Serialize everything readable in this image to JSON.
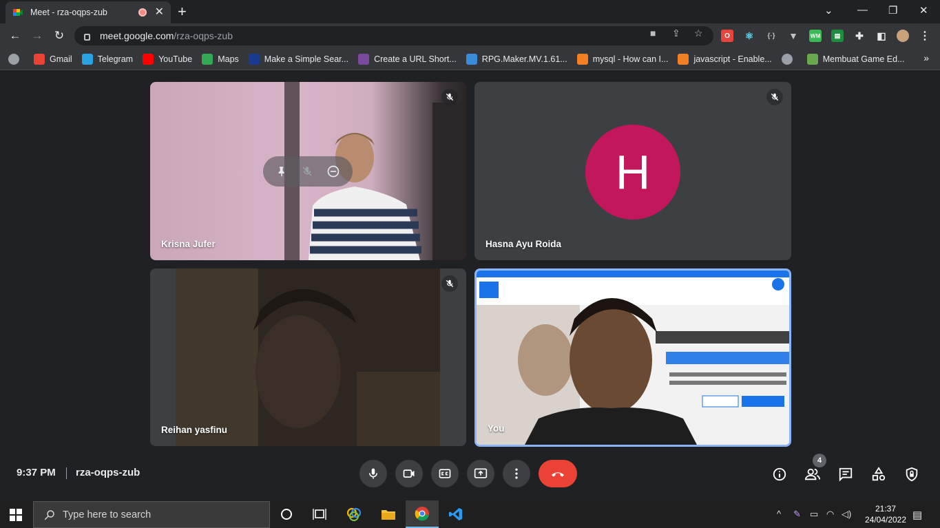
{
  "browser": {
    "tab_title": "Meet - rza-oqps-zub",
    "url_host": "meet.google.com",
    "url_path": "/rza-oqps-zub"
  },
  "bookmarks": [
    {
      "label": "",
      "icon": "globe-icon",
      "color": "#9aa0a6"
    },
    {
      "label": "Gmail",
      "icon": "gmail-icon",
      "color": "#ea4335"
    },
    {
      "label": "Telegram",
      "icon": "telegram-icon",
      "color": "#2aa3e0"
    },
    {
      "label": "YouTube",
      "icon": "youtube-icon",
      "color": "#ff0000"
    },
    {
      "label": "Maps",
      "icon": "maps-icon",
      "color": "#34a853"
    },
    {
      "label": "Make a Simple Sear...",
      "icon": "bookmark-icon",
      "color": "#1a3a8f"
    },
    {
      "label": "Create a URL Short...",
      "icon": "bookmark-icon",
      "color": "#7b4aa0"
    },
    {
      "label": "RPG.Maker.MV.1.61...",
      "icon": "bookmark-icon",
      "color": "#3a8bd8"
    },
    {
      "label": "mysql - How can I...",
      "icon": "stackoverflow-icon",
      "color": "#f48024"
    },
    {
      "label": "javascript - Enable...",
      "icon": "stackoverflow-icon",
      "color": "#f48024"
    },
    {
      "label": "",
      "icon": "globe-icon",
      "color": "#9aa0a6"
    },
    {
      "label": "Membuat Game Ed...",
      "icon": "bookmark-icon",
      "color": "#6aa84f"
    }
  ],
  "participants": [
    {
      "name": "Krisna Jufer",
      "muted": true
    },
    {
      "name": "Hasna Ayu Roida",
      "muted": true,
      "avatar_letter": "H",
      "avatar_color": "#c2185b"
    },
    {
      "name": "Reihan yasfinu",
      "muted": true
    },
    {
      "name": "You",
      "muted": false
    }
  ],
  "meeting": {
    "time": "9:37 PM",
    "code": "rza-oqps-zub",
    "people_count": "4"
  },
  "taskbar": {
    "search_placeholder": "Type here to search",
    "time": "21:37",
    "date": "24/04/2022"
  }
}
